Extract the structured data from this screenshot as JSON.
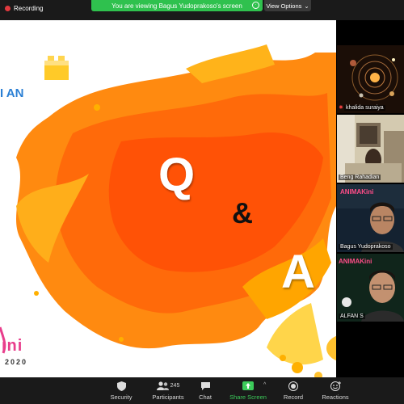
{
  "topbar": {
    "recording_label": "Recording",
    "viewing_text": "You are viewing Bagus Yudoprakoso's screen",
    "view_options_label": "View Options"
  },
  "slide": {
    "left_text": "I AN",
    "q": "Q",
    "amp": "&",
    "a": "A",
    "brand_fragment": "ini",
    "year_fragment": "2020"
  },
  "participants": [
    {
      "name": "khalida suraiya"
    },
    {
      "name": "Beng Rahadian"
    },
    {
      "name": "Bagus Yudoprakoso"
    },
    {
      "name": "ALFAN S"
    }
  ],
  "toolbar": {
    "security": "Security",
    "participants": "Participants",
    "participants_count": "245",
    "chat": "Chat",
    "share_screen": "Share Screen",
    "record": "Record",
    "reactions": "Reactions"
  },
  "colors": {
    "orange_main": "#ff7a0c",
    "orange_light": "#ffb000",
    "yellow": "#ffd54a",
    "share_green": "#3ccb5a",
    "recording_red": "#e0393e"
  }
}
